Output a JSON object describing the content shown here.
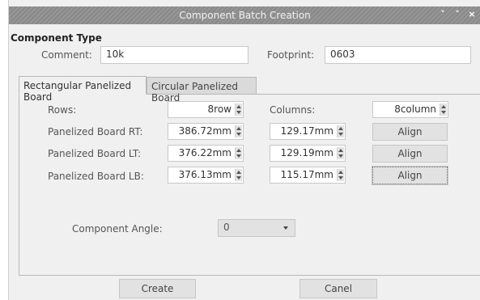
{
  "window": {
    "title": "Component Batch Creation"
  },
  "title_buttons": [
    {
      "glyph": "˅",
      "name": "minimize-icon"
    },
    {
      "glyph": "˄",
      "name": "maximize-icon"
    },
    {
      "glyph": "×",
      "name": "close-icon"
    }
  ],
  "component_type": {
    "heading": "Component Type",
    "comment_label": "Comment:",
    "comment_value": "10k",
    "footprint_label": "Footprint:",
    "footprint_value": "0603"
  },
  "tabs": [
    {
      "label": "Rectangular Panelized Board",
      "active": true
    },
    {
      "label": "Circular Panelized Board",
      "active": false
    }
  ],
  "grid": {
    "rows_label": "Rows:",
    "rows_value": "8row",
    "columns_label": "Columns:",
    "columns_value": "8column",
    "rt_label": "Panelized Board RT:",
    "rt_x": "386.72mm",
    "rt_y": "129.17mm",
    "lt_label": "Panelized Board LT:",
    "lt_x": "376.22mm",
    "lt_y": "129.19mm",
    "lb_label": "Panelized Board LB:",
    "lb_x": "376.13mm",
    "lb_y": "115.17mm",
    "align_label": "Align"
  },
  "angle": {
    "label": "Component Angle:",
    "value": "0"
  },
  "footer": {
    "create_label": "Create",
    "cancel_label": "Canel"
  }
}
